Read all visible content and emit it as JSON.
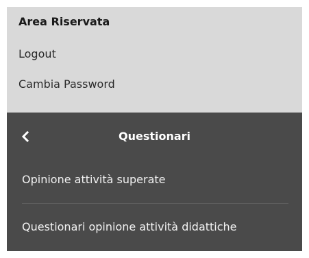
{
  "account": {
    "title": "Area Riservata",
    "links": [
      {
        "label": "Logout"
      },
      {
        "label": "Cambia Password"
      }
    ]
  },
  "menu": {
    "back_icon": "chevron-left-icon",
    "title": "Questionari",
    "items": [
      {
        "label": "Opinione attività superate"
      },
      {
        "label": "Questionari opinione attività didattiche"
      }
    ]
  },
  "colors": {
    "account_bg": "#d9d9d9",
    "menu_bg": "#4a4a4a",
    "menu_text": "#ffffff"
  }
}
